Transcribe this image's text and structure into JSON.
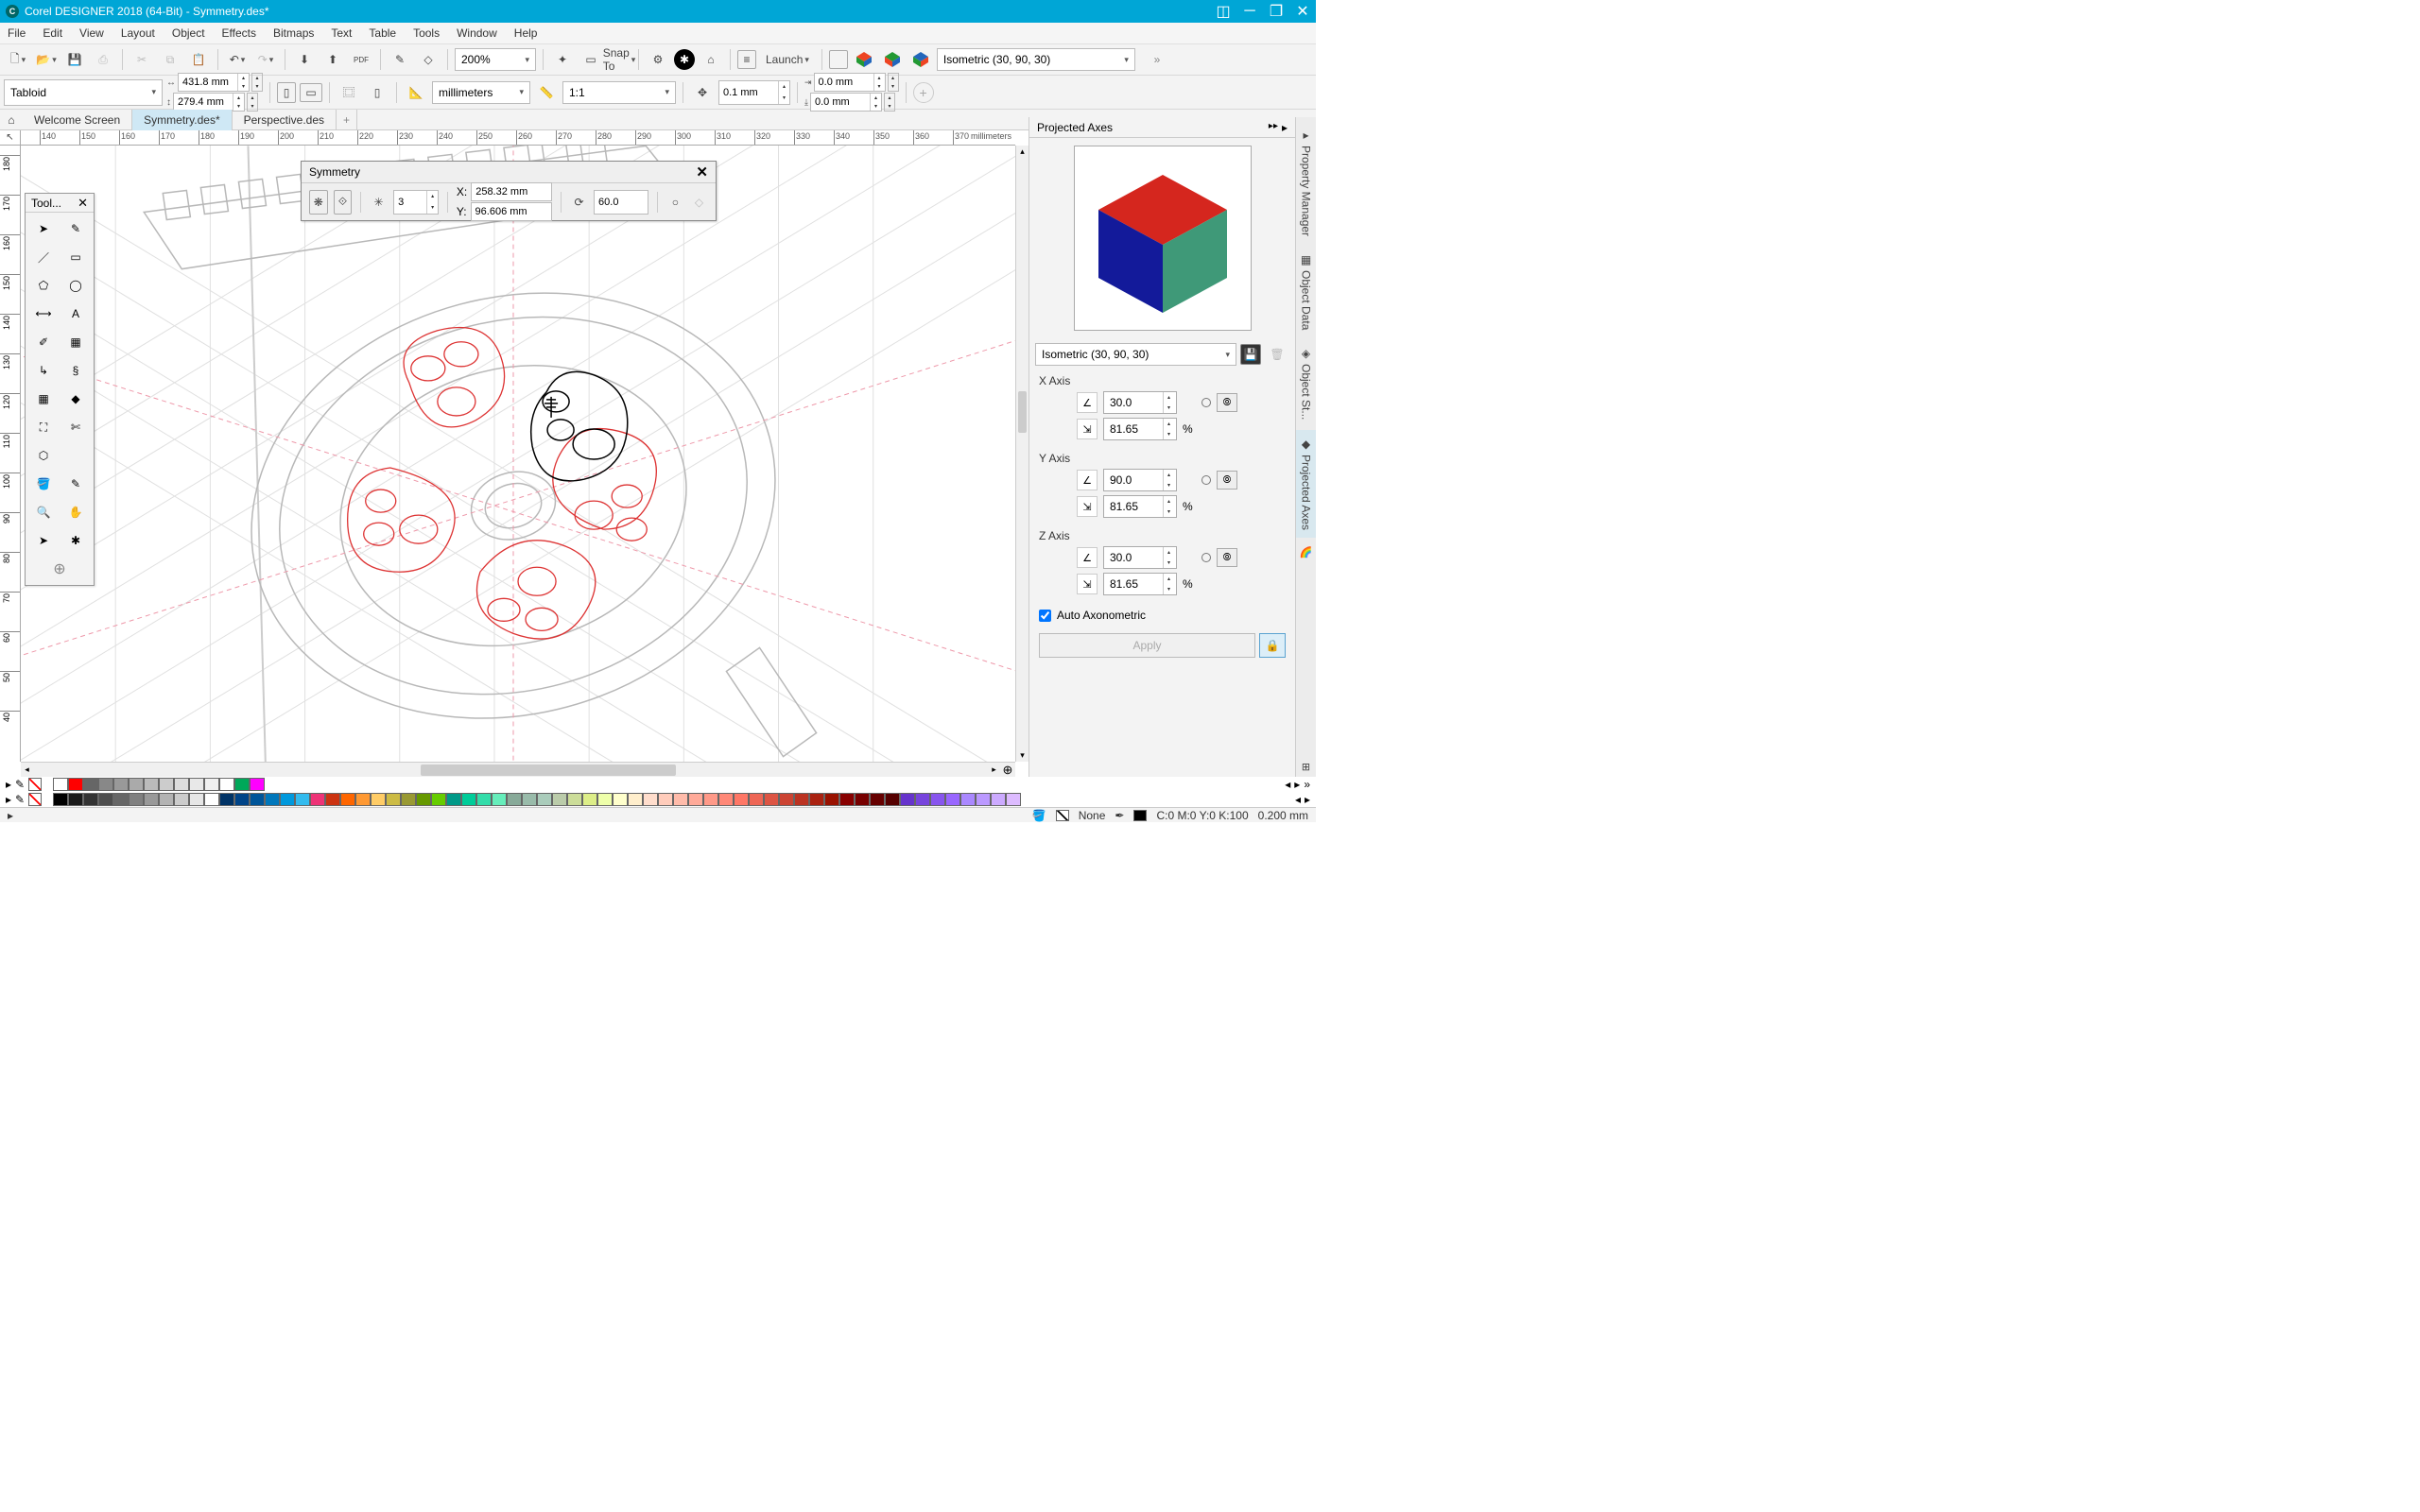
{
  "title": "Corel DESIGNER 2018 (64-Bit) - Symmetry.des*",
  "menu": [
    "File",
    "Edit",
    "View",
    "Layout",
    "Object",
    "Effects",
    "Bitmaps",
    "Text",
    "Table",
    "Tools",
    "Window",
    "Help"
  ],
  "toolbar1": {
    "zoom": "200%",
    "snap_label": "Snap To",
    "launch_label": "Launch",
    "profile": "Isometric (30, 90, 30)"
  },
  "toolbar2": {
    "page_preset": "Tabloid",
    "width": "431.8 mm",
    "height": "279.4 mm",
    "units": "millimeters",
    "scale": "1:1",
    "nudge": "0.1 mm",
    "dup_x": "0.0 mm",
    "dup_y": "0.0 mm"
  },
  "tabs": {
    "welcome": "Welcome Screen",
    "doc1": "Symmetry.des*",
    "doc2": "Perspective.des"
  },
  "toolbox_title": "Tool...",
  "ruler_units": "millimeters",
  "symmetry": {
    "title": "Symmetry",
    "copies": "3",
    "x_label": "X:",
    "y_label": "Y:",
    "x": "258.32 mm",
    "y": "96.606 mm",
    "angle": "60.0"
  },
  "docker": {
    "title": "Projected Axes",
    "preset": "Isometric (30, 90, 30)",
    "x_axis_label": "X Axis",
    "y_axis_label": "Y Axis",
    "z_axis_label": "Z Axis",
    "x_angle": "30.0",
    "x_scale": "81.65",
    "y_angle": "90.0",
    "y_scale": "81.65",
    "z_angle": "30.0",
    "z_scale": "81.65",
    "pct": "%",
    "auto_axo": "Auto Axonometric",
    "apply": "Apply",
    "tabs": [
      "Property Manager",
      "Object Data",
      "Object St...",
      "Projected Axes"
    ]
  },
  "status": {
    "fill_label": "None",
    "color": "C:0 M:0 Y:0 K:100",
    "outline": "0.200 mm"
  },
  "ruler_h_ticks": [
    140,
    150,
    160,
    170,
    180,
    190,
    200,
    210,
    220,
    230,
    240,
    250,
    260,
    270,
    280,
    290,
    300,
    310,
    320,
    330,
    340,
    350,
    360,
    370
  ],
  "ruler_v_ticks": [
    180,
    170,
    160,
    150,
    140,
    130,
    120,
    110,
    100,
    90,
    80,
    70,
    60,
    50,
    40
  ],
  "palette1": [
    "#ffffff",
    "#ff0000",
    "#666666",
    "#888888",
    "#999999",
    "#aaaaaa",
    "#bbbbbb",
    "#cccccc",
    "#dddddd",
    "#e8e8e8",
    "#f0f0f0",
    "#ffffff",
    "#00a859",
    "#ff00ff"
  ],
  "palette2": [
    "#000000",
    "#1a1a1a",
    "#333333",
    "#4d4d4d",
    "#666666",
    "#808080",
    "#999999",
    "#b3b3b3",
    "#cccccc",
    "#e6e6e6",
    "#ffffff",
    "#003366",
    "#004488",
    "#005599",
    "#0077bb",
    "#0099dd",
    "#33bbee",
    "#ee3377",
    "#cc3311",
    "#ff6600",
    "#ff9933",
    "#ffcc66",
    "#ccbb44",
    "#999933",
    "#669900",
    "#66cc00",
    "#009988",
    "#00cc99",
    "#33ddaa",
    "#66eebb",
    "#88aa99",
    "#99bbaa",
    "#aaccbb",
    "#bbccaa",
    "#ccdd99",
    "#ddee88",
    "#eeffaa",
    "#ffffcc",
    "#ffeecc",
    "#ffddcc",
    "#ffccbb",
    "#ffbbaa",
    "#ffaa99",
    "#ff9988",
    "#ff8877",
    "#ff7766",
    "#ee6655",
    "#dd5544",
    "#cc4433",
    "#bb3322",
    "#aa2211",
    "#991100",
    "#880000",
    "#770000",
    "#660000",
    "#550000",
    "#6633cc",
    "#7744dd",
    "#8855ee",
    "#9966ff",
    "#aa88ff",
    "#bb99ff",
    "#ccaaff",
    "#ddbbff"
  ]
}
